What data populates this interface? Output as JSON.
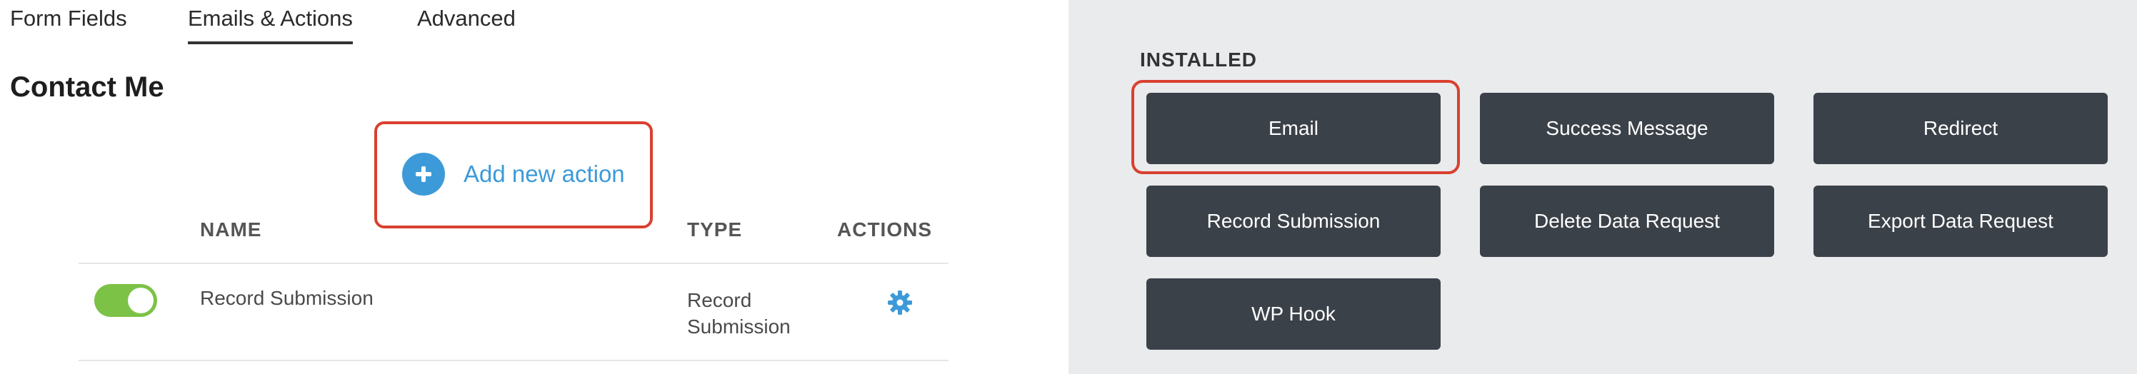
{
  "tabs": [
    {
      "label": "Form Fields"
    },
    {
      "label": "Emails & Actions",
      "active": true
    },
    {
      "label": "Advanced"
    }
  ],
  "form": {
    "title": "Contact Me"
  },
  "add_action": {
    "label": "Add new action",
    "icon": "plus-circle-icon"
  },
  "table": {
    "columns": [
      "NAME",
      "TYPE",
      "ACTIONS"
    ],
    "rows": [
      {
        "name": "Record Submission",
        "type": "Record Submission",
        "enabled": true,
        "action_icon": "gear-icon"
      }
    ]
  },
  "installed": {
    "label": "INSTALLED",
    "actions": [
      {
        "label": "Email"
      },
      {
        "label": "Success Message"
      },
      {
        "label": "Redirect"
      },
      {
        "label": "Record Submission"
      },
      {
        "label": "Delete Data Request"
      },
      {
        "label": "Export Data Request"
      },
      {
        "label": "WP Hook"
      }
    ]
  },
  "colors": {
    "accent_blue": "#3d9ad8",
    "toggle_on": "#7cc246",
    "button_dark": "#3b4149",
    "highlight_red": "#d9402f",
    "right_bg": "#eaebed"
  }
}
